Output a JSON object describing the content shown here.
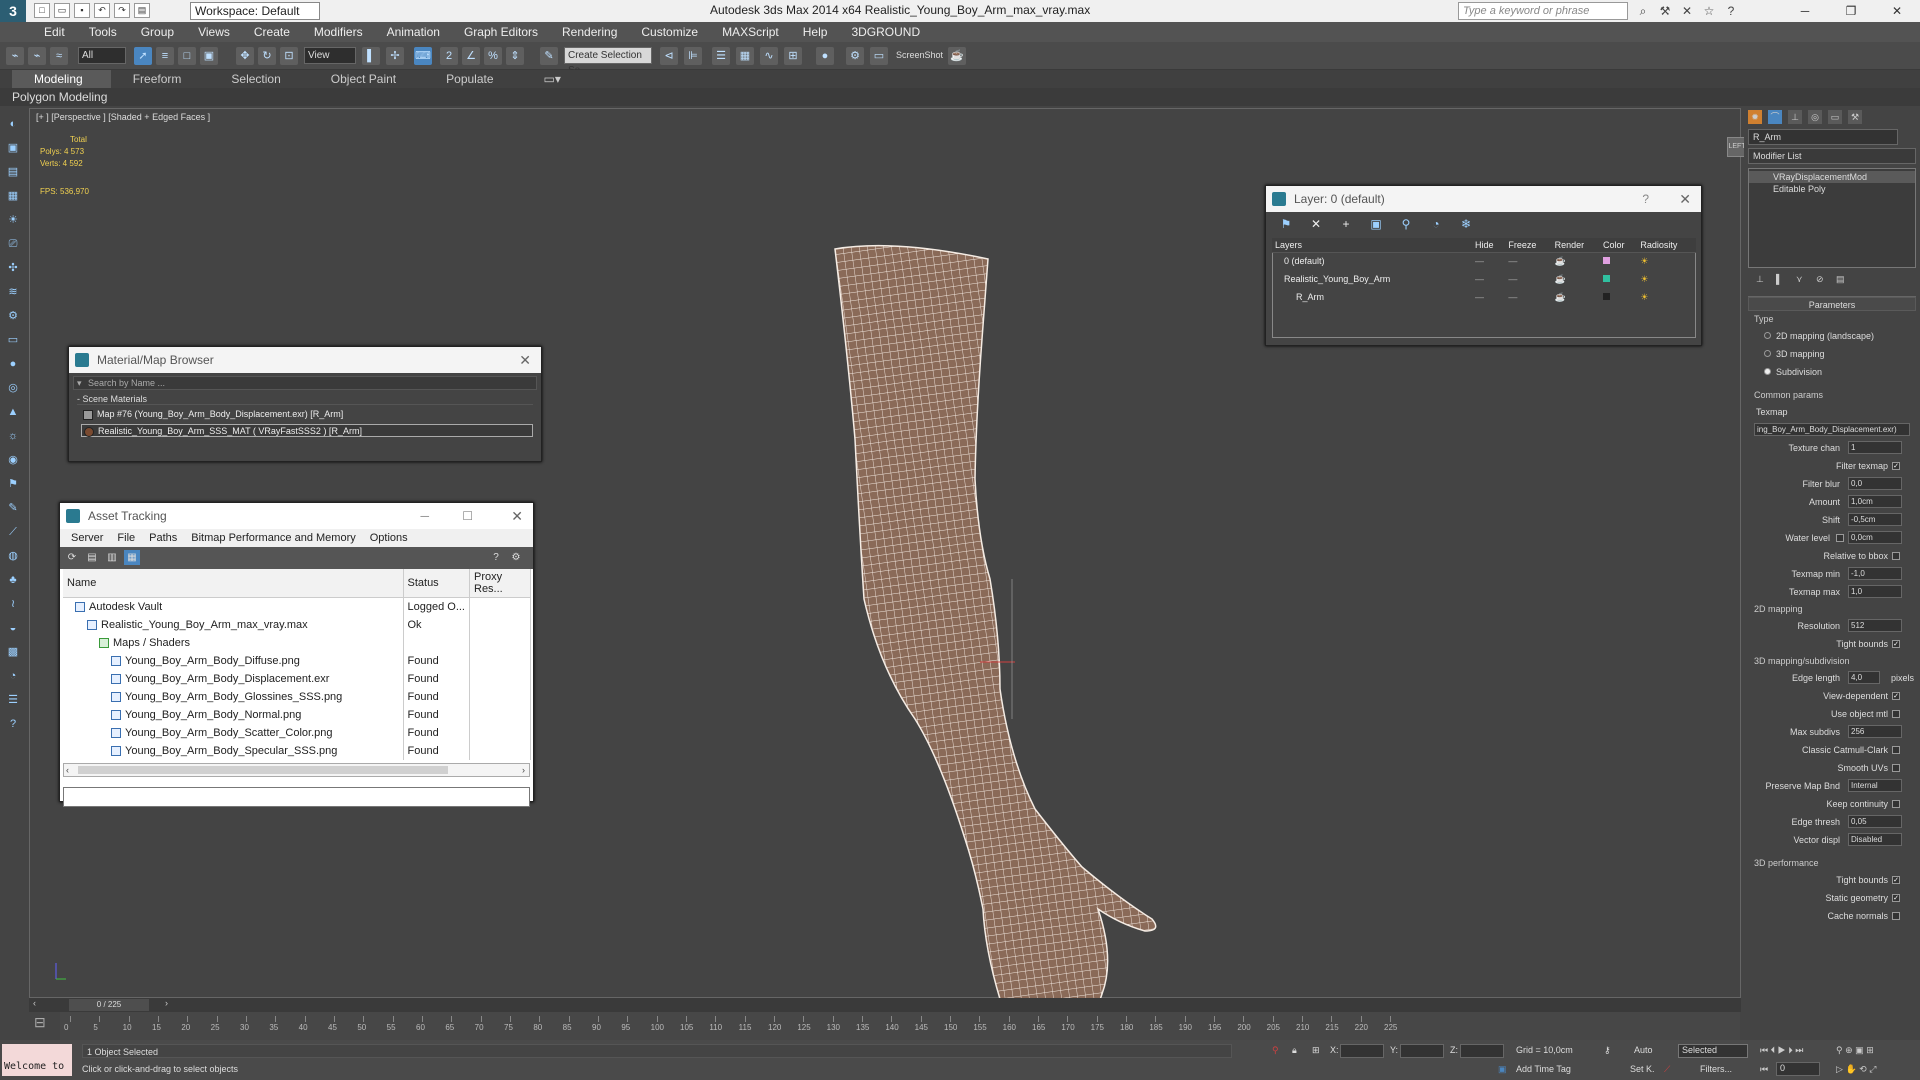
{
  "titlebar": {
    "logo": "3",
    "workspace": "Workspace: Default",
    "title": "Autodesk 3ds Max  2014 x64     Realistic_Young_Boy_Arm_max_vray.max",
    "search_placeholder": "Type a keyword or phrase"
  },
  "menu": [
    "Edit",
    "Tools",
    "Group",
    "Views",
    "Create",
    "Modifiers",
    "Animation",
    "Graph Editors",
    "Rendering",
    "Customize",
    "MAXScript",
    "Help",
    "3DGROUND"
  ],
  "toolbar": {
    "selection_filter": "All",
    "ref_coord": "View",
    "named_selection": "Create Selection Se",
    "screenshot_label": "ScreenShot"
  },
  "ribbon": {
    "tabs": [
      "Modeling",
      "Freeform",
      "Selection",
      "Object Paint",
      "Populate"
    ],
    "active": "Modeling",
    "subtitle": "Polygon Modeling"
  },
  "viewport": {
    "label": "[+ ] [Perspective ] [Shaded + Edged Faces ]",
    "total_label": "Total",
    "polys": "Polys:  4 573",
    "verts": "Verts:  4 592",
    "fps": "FPS:    536,970",
    "viewcube_label": "LEFT"
  },
  "material_browser": {
    "title": "Material/Map Browser",
    "search_placeholder": "Search by Name ...",
    "category": "- Scene Materials",
    "items": [
      "Map #76 (Young_Boy_Arm_Body_Displacement.exr) [R_Arm]",
      "Realistic_Young_Boy_Arm_SSS_MAT ( VRayFastSSS2 ) [R_Arm]"
    ]
  },
  "asset_tracking": {
    "title": "Asset Tracking",
    "menu": [
      "Server",
      "File",
      "Paths",
      "Bitmap Performance and Memory",
      "Options"
    ],
    "columns": [
      "Name",
      "Status",
      "Proxy Res..."
    ],
    "rows": [
      {
        "name": "Autodesk Vault",
        "status": "Logged O...",
        "indent": 1
      },
      {
        "name": "Realistic_Young_Boy_Arm_max_vray.max",
        "status": "Ok",
        "indent": 2
      },
      {
        "name": "Maps / Shaders",
        "status": "",
        "indent": 3
      },
      {
        "name": "Young_Boy_Arm_Body_Diffuse.png",
        "status": "Found",
        "indent": 4
      },
      {
        "name": "Young_Boy_Arm_Body_Displacement.exr",
        "status": "Found",
        "indent": 4
      },
      {
        "name": "Young_Boy_Arm_Body_Glossines_SSS.png",
        "status": "Found",
        "indent": 4
      },
      {
        "name": "Young_Boy_Arm_Body_Normal.png",
        "status": "Found",
        "indent": 4
      },
      {
        "name": "Young_Boy_Arm_Body_Scatter_Color.png",
        "status": "Found",
        "indent": 4
      },
      {
        "name": "Young_Boy_Arm_Body_Specular_SSS.png",
        "status": "Found",
        "indent": 4
      }
    ]
  },
  "layer_manager": {
    "title": "Layer: 0 (default)",
    "columns": [
      "Layers",
      "Hide",
      "Freeze",
      "Render",
      "Color",
      "Radiosity"
    ],
    "rows": [
      {
        "name": "0 (default)",
        "indent": 1,
        "color": "#e0a0e0"
      },
      {
        "name": "Realistic_Young_Boy_Arm",
        "indent": 1,
        "color": "#30c0a0"
      },
      {
        "name": "R_Arm",
        "indent": 2,
        "color": "#222222"
      }
    ]
  },
  "command_panel": {
    "object_name": "R_Arm",
    "modifier_list": "Modifier List",
    "stack": [
      "VRayDisplacementMod",
      "Editable Poly"
    ],
    "parameters_title": "Parameters",
    "type_label": "Type",
    "type_options": [
      "2D mapping (landscape)",
      "3D mapping",
      "Subdivision"
    ],
    "type_selected": "Subdivision",
    "common_params": "Common params",
    "texmap_label": "Texmap",
    "texmap_value": "ing_Boy_Arm_Body_Displacement.exr)",
    "texture_chan_label": "Texture chan",
    "texture_chan": "1",
    "filter_texmap": "Filter texmap",
    "filter_blur_label": "Filter blur",
    "filter_blur": "0,0",
    "amount_label": "Amount",
    "amount": "1,0cm",
    "shift_label": "Shift",
    "shift": "-0,5cm",
    "water_level_label": "Water level",
    "water_level": "0,0cm",
    "relative_bbox": "Relative to bbox",
    "texmap_min_label": "Texmap min",
    "texmap_min": "-1,0",
    "texmap_max_label": "Texmap max",
    "texmap_max": "1,0",
    "mapping2d": "2D mapping",
    "resolution_label": "Resolution",
    "resolution": "512",
    "tight_bounds": "Tight bounds",
    "mapping3d": "3D mapping/subdivision",
    "edge_length_label": "Edge length",
    "edge_length": "4,0",
    "pixels": "pixels",
    "view_dependent": "View-dependent",
    "use_object_mtl": "Use object mtl",
    "max_subdivs_label": "Max subdivs",
    "max_subdivs": "256",
    "classic_catmull": "Classic Catmull-Clark",
    "smooth_uvs": "Smooth UVs",
    "preserve_map_label": "Preserve Map Bnd",
    "preserve_map": "Internal",
    "keep_continuity": "Keep continuity",
    "edge_thresh_label": "Edge thresh",
    "edge_thresh": "0,05",
    "vector_displ_label": "Vector displ",
    "vector_displ": "Disabled",
    "performance": "3D performance",
    "tight_bounds2": "Tight bounds",
    "static_geometry": "Static geometry",
    "cache_normals": "Cache normals"
  },
  "timeline": {
    "frame": "0 / 225",
    "ticks": [
      0,
      5,
      10,
      15,
      20,
      25,
      30,
      35,
      40,
      45,
      50,
      55,
      60,
      65,
      70,
      75,
      80,
      85,
      90,
      95,
      100,
      105,
      110,
      115,
      120,
      125,
      130,
      135,
      140,
      145,
      150,
      155,
      160,
      165,
      170,
      175,
      180,
      185,
      190,
      195,
      200,
      205,
      210,
      215,
      220,
      225
    ]
  },
  "status": {
    "maxscript": "Welcome to",
    "selected": "1 Object Selected",
    "prompt": "Click or click-and-drag to select objects",
    "x": "X:",
    "y": "Y:",
    "z": "Z:",
    "grid": "Grid = 10,0cm",
    "add_time_tag": "Add Time Tag",
    "auto": "Auto",
    "set_key": "Set K.",
    "selected_dd": "Selected",
    "filters": "Filters...",
    "frame_num": "0"
  }
}
